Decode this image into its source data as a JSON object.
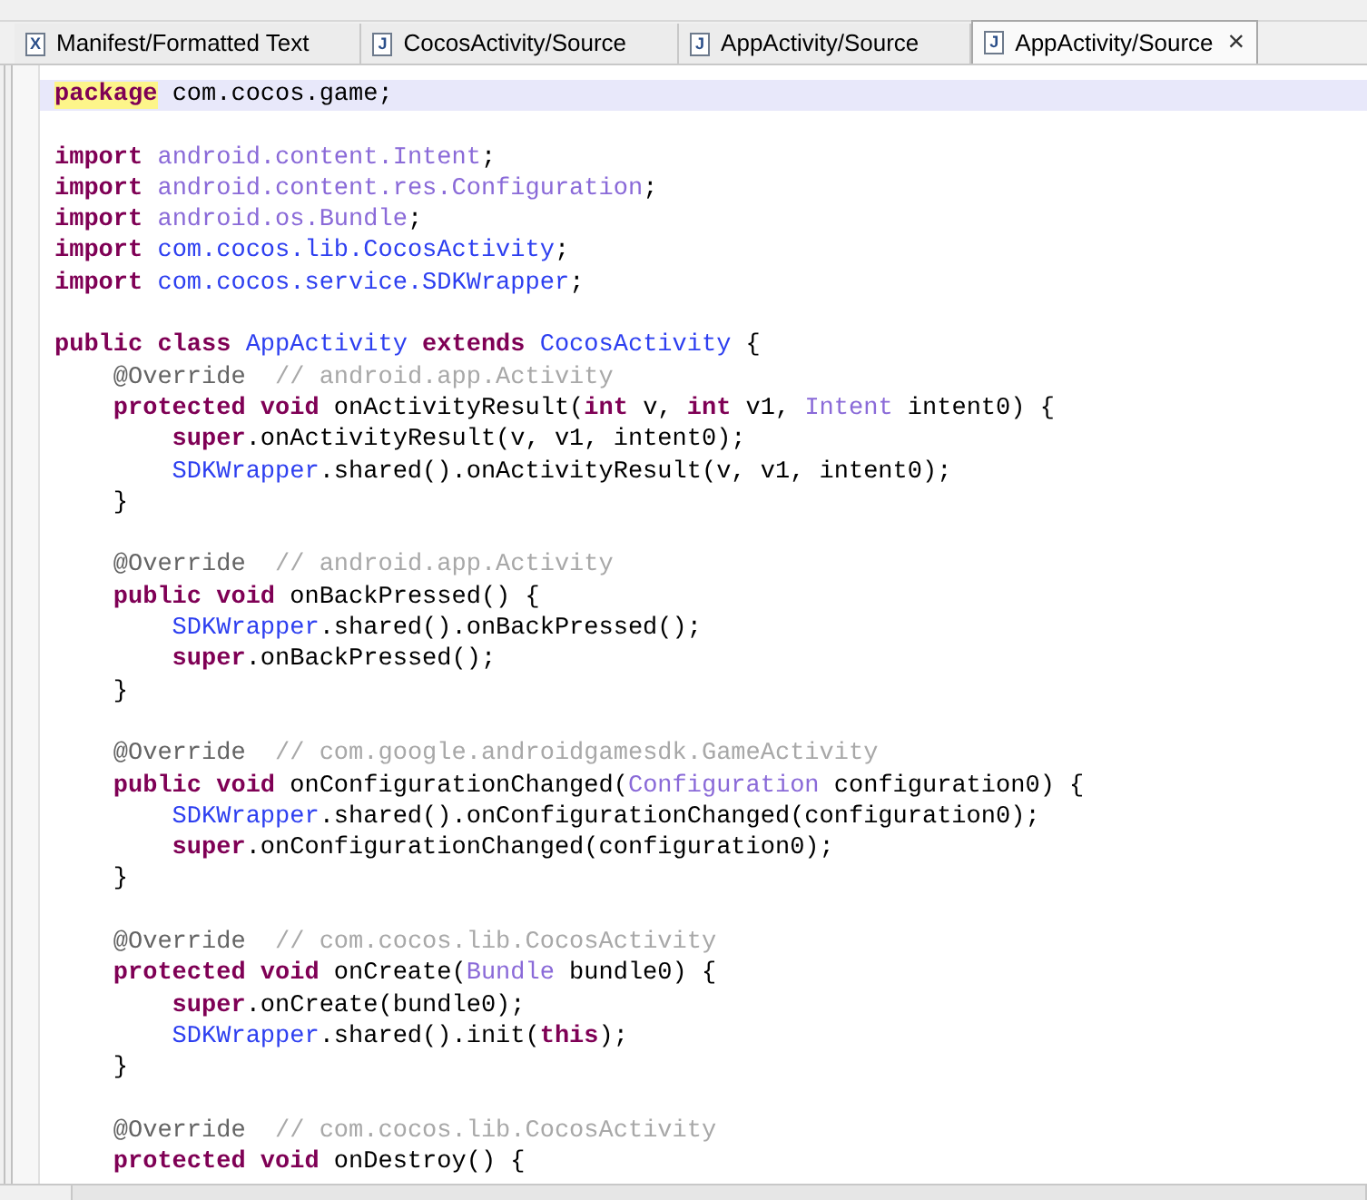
{
  "tabs": [
    {
      "label": "Manifest/Formatted Text",
      "icon_glyph": "X",
      "selected": false
    },
    {
      "label": "CocosActivity/Source",
      "icon_glyph": "J",
      "selected": false
    },
    {
      "label": "AppActivity/Source",
      "icon_glyph": "J",
      "selected": false
    },
    {
      "label": "AppActivity/Source",
      "icon_glyph": "J",
      "selected": true,
      "close": "×"
    }
  ],
  "editor": {
    "lines": [
      {
        "kind": "code",
        "current": true,
        "tokens": [
          {
            "kind": "keyword",
            "text": "package"
          },
          {
            "kind": "plain",
            "text": " com.cocos.game;"
          }
        ]
      },
      {
        "kind": "blank"
      },
      {
        "kind": "code",
        "tokens": [
          {
            "kind": "keyword",
            "text": "import "
          },
          {
            "kind": "type",
            "text": "android.content.Intent"
          },
          {
            "kind": "plain",
            "text": ";"
          }
        ]
      },
      {
        "kind": "code",
        "tokens": [
          {
            "kind": "keyword",
            "text": "import "
          },
          {
            "kind": "type",
            "text": "android.content.res.Configuration"
          },
          {
            "kind": "plain",
            "text": ";"
          }
        ]
      },
      {
        "kind": "code",
        "tokens": [
          {
            "kind": "keyword",
            "text": "import "
          },
          {
            "kind": "type",
            "text": "android.os.Bundle"
          },
          {
            "kind": "plain",
            "text": ";"
          }
        ]
      },
      {
        "kind": "code",
        "tokens": [
          {
            "kind": "keyword",
            "text": "import "
          },
          {
            "kind": "class",
            "text": "com.cocos.lib.CocosActivity"
          },
          {
            "kind": "plain",
            "text": ";"
          }
        ]
      },
      {
        "kind": "code",
        "tokens": [
          {
            "kind": "keyword",
            "text": "import "
          },
          {
            "kind": "class",
            "text": "com.cocos.service.SDKWrapper"
          },
          {
            "kind": "plain",
            "text": ";"
          }
        ]
      },
      {
        "kind": "blank"
      },
      {
        "kind": "code",
        "tokens": [
          {
            "kind": "keyword",
            "text": "public class "
          },
          {
            "kind": "class",
            "text": "AppActivity "
          },
          {
            "kind": "keyword",
            "text": "extends "
          },
          {
            "kind": "class",
            "text": "CocosActivity"
          },
          {
            "kind": "plain",
            "text": " {"
          }
        ]
      },
      {
        "kind": "code",
        "tokens": [
          {
            "kind": "annotation",
            "text": "    @Override"
          },
          {
            "kind": "comment",
            "text": "  // android.app.Activity"
          }
        ]
      },
      {
        "kind": "code",
        "tokens": [
          {
            "kind": "keyword",
            "text": "    protected void"
          },
          {
            "kind": "plain",
            "text": " onActivityResult("
          },
          {
            "kind": "keyword",
            "text": "int"
          },
          {
            "kind": "plain",
            "text": " v, "
          },
          {
            "kind": "keyword",
            "text": "int"
          },
          {
            "kind": "plain",
            "text": " v1, "
          },
          {
            "kind": "type",
            "text": "Intent"
          },
          {
            "kind": "plain",
            "text": " intent0) {"
          }
        ]
      },
      {
        "kind": "code",
        "tokens": [
          {
            "kind": "keyword",
            "text": "        super"
          },
          {
            "kind": "plain",
            "text": ".onActivityResult(v, v1, intent0);"
          }
        ]
      },
      {
        "kind": "code",
        "tokens": [
          {
            "kind": "class",
            "text": "        SDKWrapper"
          },
          {
            "kind": "plain",
            "text": ".shared().onActivityResult(v, v1, intent0);"
          }
        ]
      },
      {
        "kind": "code",
        "tokens": [
          {
            "kind": "plain",
            "text": "    }"
          }
        ]
      },
      {
        "kind": "blank"
      },
      {
        "kind": "code",
        "tokens": [
          {
            "kind": "annotation",
            "text": "    @Override"
          },
          {
            "kind": "comment",
            "text": "  // android.app.Activity"
          }
        ]
      },
      {
        "kind": "code",
        "tokens": [
          {
            "kind": "keyword",
            "text": "    public void"
          },
          {
            "kind": "plain",
            "text": " onBackPressed() {"
          }
        ]
      },
      {
        "kind": "code",
        "tokens": [
          {
            "kind": "class",
            "text": "        SDKWrapper"
          },
          {
            "kind": "plain",
            "text": ".shared().onBackPressed();"
          }
        ]
      },
      {
        "kind": "code",
        "tokens": [
          {
            "kind": "keyword",
            "text": "        super"
          },
          {
            "kind": "plain",
            "text": ".onBackPressed();"
          }
        ]
      },
      {
        "kind": "code",
        "tokens": [
          {
            "kind": "plain",
            "text": "    }"
          }
        ]
      },
      {
        "kind": "blank"
      },
      {
        "kind": "code",
        "tokens": [
          {
            "kind": "annotation",
            "text": "    @Override"
          },
          {
            "kind": "comment",
            "text": "  // com.google.androidgamesdk.GameActivity"
          }
        ]
      },
      {
        "kind": "code",
        "tokens": [
          {
            "kind": "keyword",
            "text": "    public void"
          },
          {
            "kind": "plain",
            "text": " onConfigurationChanged("
          },
          {
            "kind": "type",
            "text": "Configuration"
          },
          {
            "kind": "plain",
            "text": " configuration0) {"
          }
        ]
      },
      {
        "kind": "code",
        "tokens": [
          {
            "kind": "class",
            "text": "        SDKWrapper"
          },
          {
            "kind": "plain",
            "text": ".shared().onConfigurationChanged(configuration0);"
          }
        ]
      },
      {
        "kind": "code",
        "tokens": [
          {
            "kind": "keyword",
            "text": "        super"
          },
          {
            "kind": "plain",
            "text": ".onConfigurationChanged(configuration0);"
          }
        ]
      },
      {
        "kind": "code",
        "tokens": [
          {
            "kind": "plain",
            "text": "    }"
          }
        ]
      },
      {
        "kind": "blank"
      },
      {
        "kind": "code",
        "tokens": [
          {
            "kind": "annotation",
            "text": "    @Override"
          },
          {
            "kind": "comment",
            "text": "  // com.cocos.lib.CocosActivity"
          }
        ]
      },
      {
        "kind": "code",
        "tokens": [
          {
            "kind": "keyword",
            "text": "    protected void"
          },
          {
            "kind": "plain",
            "text": " onCreate("
          },
          {
            "kind": "type",
            "text": "Bundle"
          },
          {
            "kind": "plain",
            "text": " bundle0) {"
          }
        ]
      },
      {
        "kind": "code",
        "tokens": [
          {
            "kind": "keyword",
            "text": "        super"
          },
          {
            "kind": "plain",
            "text": ".onCreate(bundle0);"
          }
        ]
      },
      {
        "kind": "code",
        "tokens": [
          {
            "kind": "class",
            "text": "        SDKWrapper"
          },
          {
            "kind": "plain",
            "text": ".shared().init("
          },
          {
            "kind": "keyword",
            "text": "this"
          },
          {
            "kind": "plain",
            "text": ");"
          }
        ]
      },
      {
        "kind": "code",
        "tokens": [
          {
            "kind": "plain",
            "text": "    }"
          }
        ]
      },
      {
        "kind": "blank"
      },
      {
        "kind": "code",
        "tokens": [
          {
            "kind": "annotation",
            "text": "    @Override"
          },
          {
            "kind": "comment",
            "text": "  // com.cocos.lib.CocosActivity"
          }
        ]
      },
      {
        "kind": "code",
        "tokens": [
          {
            "kind": "keyword",
            "text": "    protected void"
          },
          {
            "kind": "plain",
            "text": " onDestroy() {"
          }
        ]
      }
    ]
  }
}
